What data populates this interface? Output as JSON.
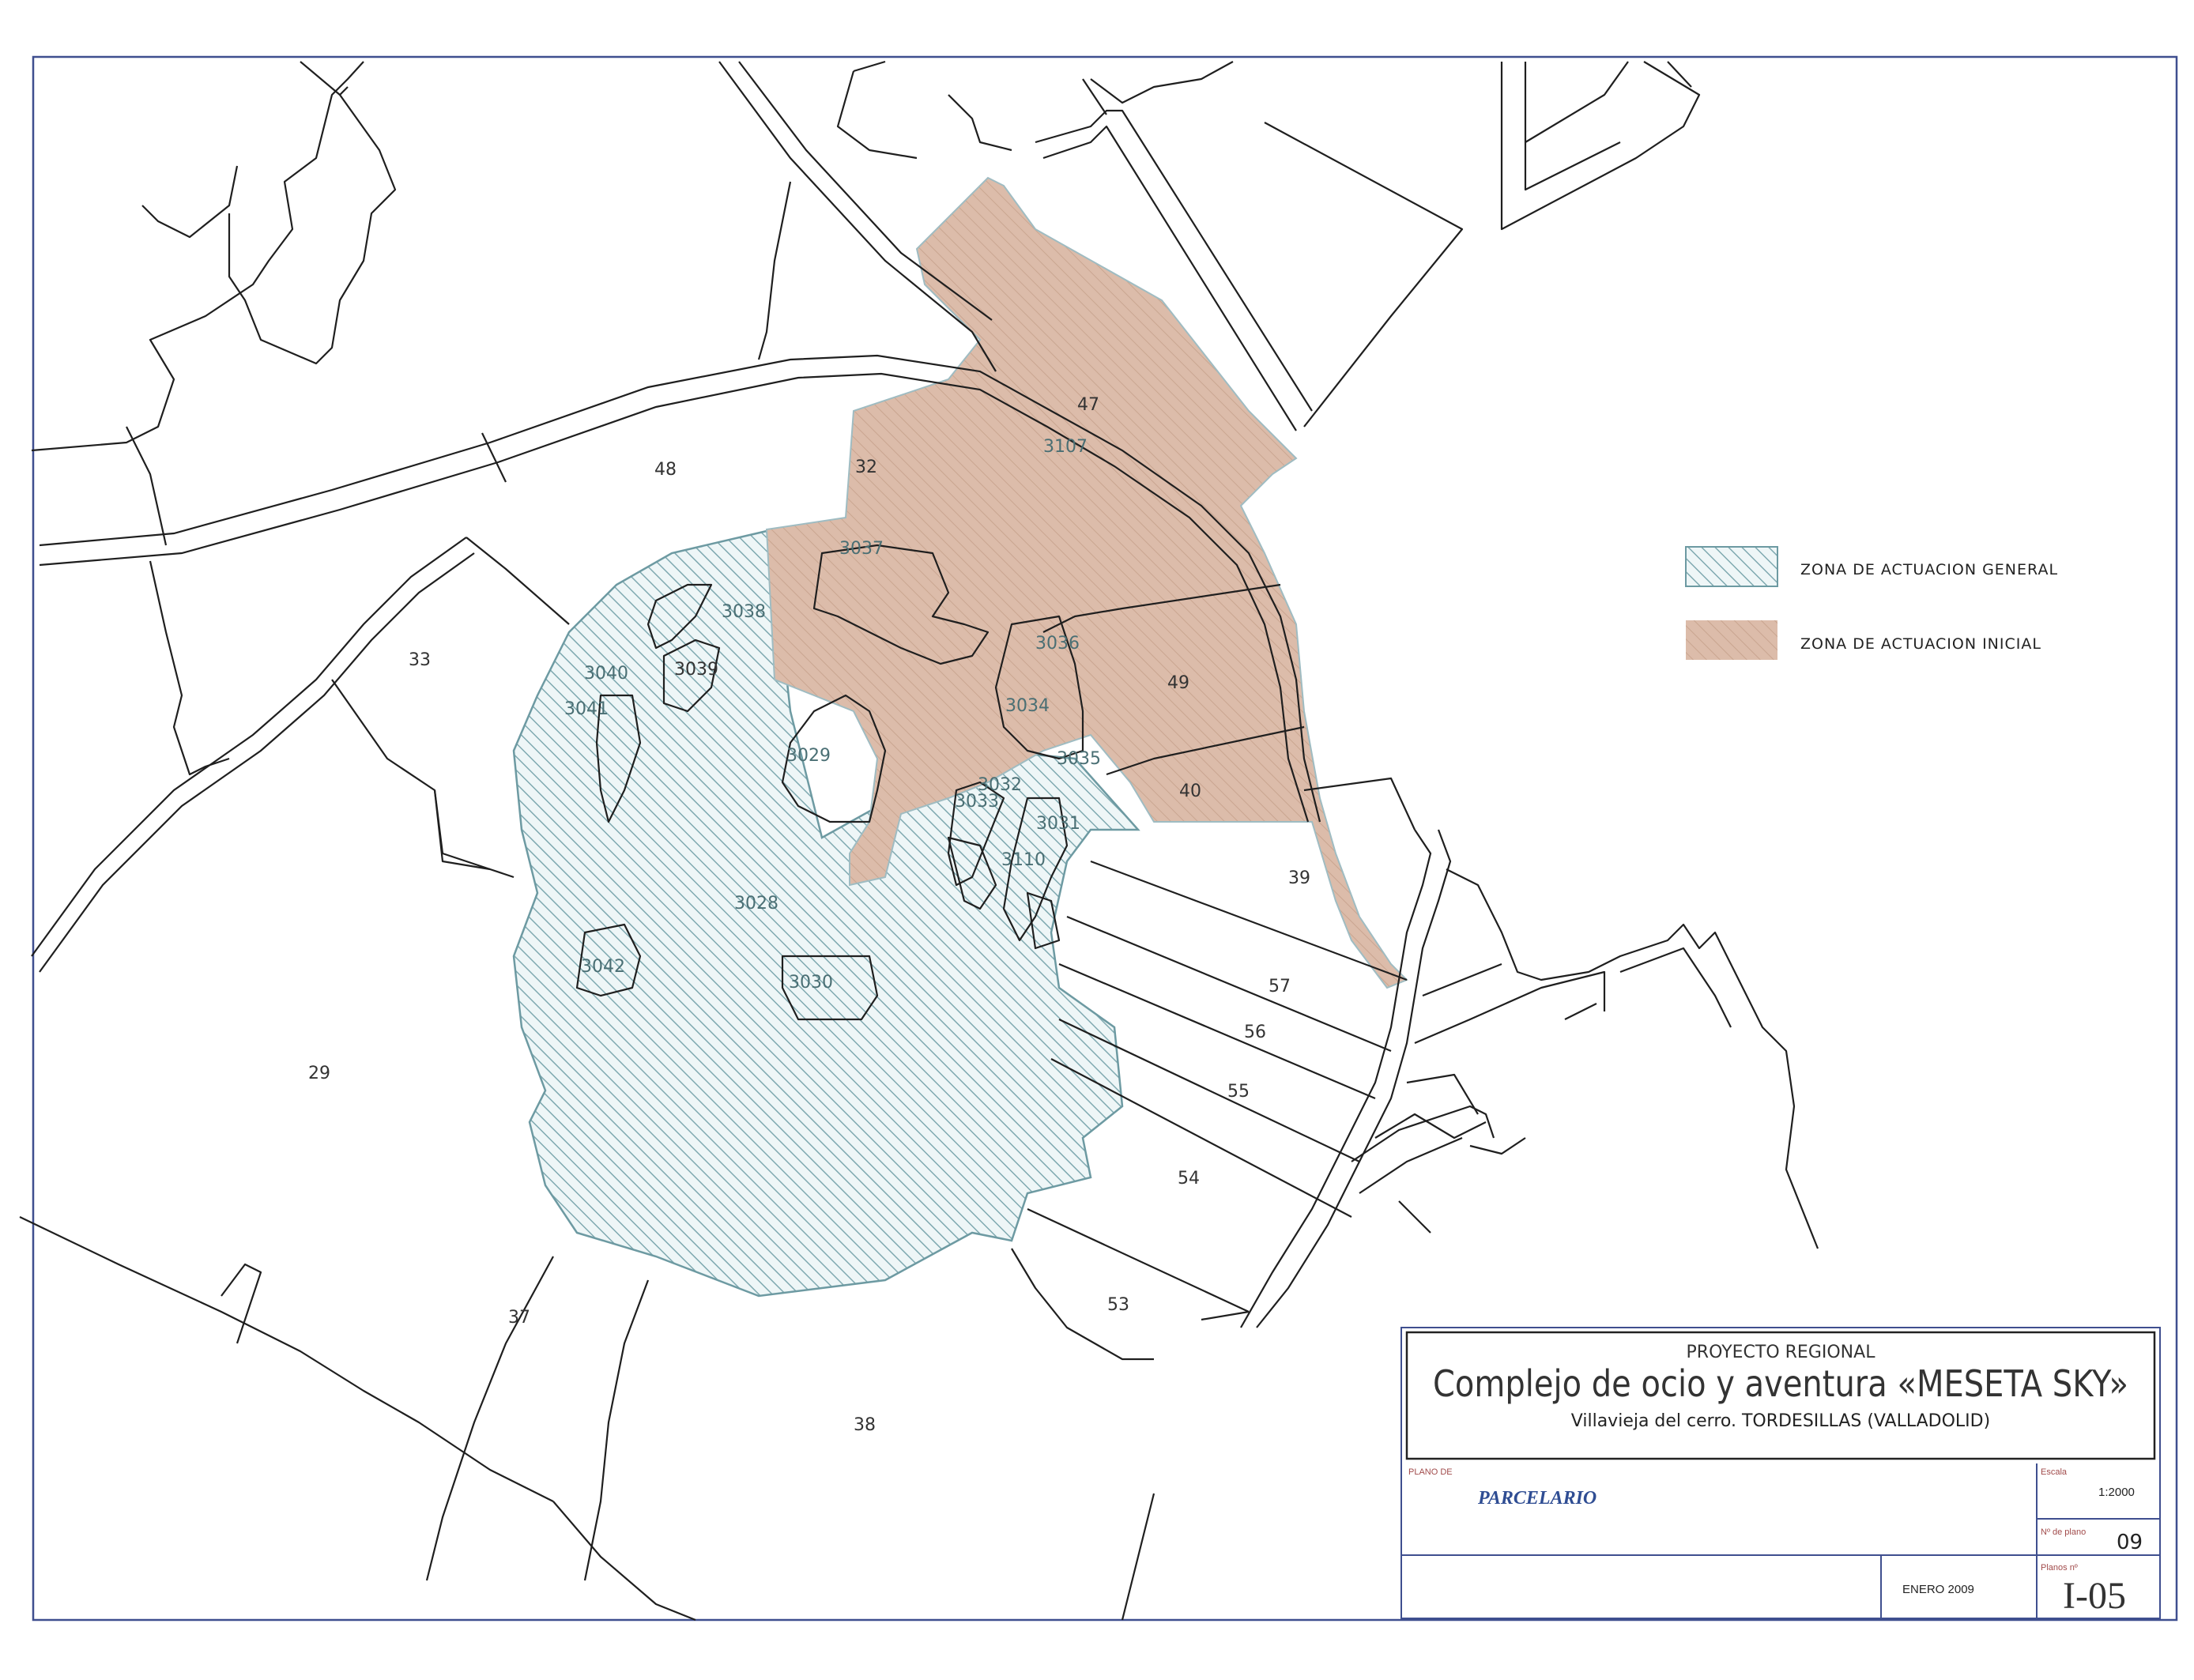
{
  "map": {
    "parcels": {
      "p47": "47",
      "p3107": "3107",
      "p48": "48",
      "p32": "32",
      "p3037": "3037",
      "p3038": "3038",
      "p33": "33",
      "p3040": "3040",
      "p3039": "3039",
      "p3041": "3041",
      "p3036": "3036",
      "p49": "49",
      "p3034": "3034",
      "p3029": "3029",
      "p3035": "3035",
      "p3032": "3032",
      "p3033": "3033",
      "p40": "40",
      "p3031": "3031",
      "p3110": "3110",
      "p39": "39",
      "p3028": "3028",
      "p3042": "3042",
      "p3030": "3030",
      "p57": "57",
      "p56": "56",
      "p29": "29",
      "p55": "55",
      "p54": "54",
      "p53": "53",
      "p37": "37",
      "p38": "38"
    }
  },
  "legend": {
    "general": {
      "label": "ZONA DE ACTUACION GENERAL",
      "color": "#8fb8c0"
    },
    "initial": {
      "label": "ZONA DE ACTUACION INICIAL",
      "color": "#d6b3a0"
    }
  },
  "title_block": {
    "project": "PROYECTO REGIONAL",
    "title": "Complejo de ocio y aventura «MESETA SKY»",
    "location": "Villavieja del cerro. TORDESILLAS (VALLADOLID)",
    "plano_de_label": "PLANO DE",
    "plano_name": "PARCELARIO",
    "escala_label": "Escala",
    "escala": "1:2000",
    "no_plano_label": "Nº de plano",
    "no_plano": "09",
    "date": "ENERO 2009",
    "planos_label": "Planos nº",
    "code": "I-05"
  }
}
